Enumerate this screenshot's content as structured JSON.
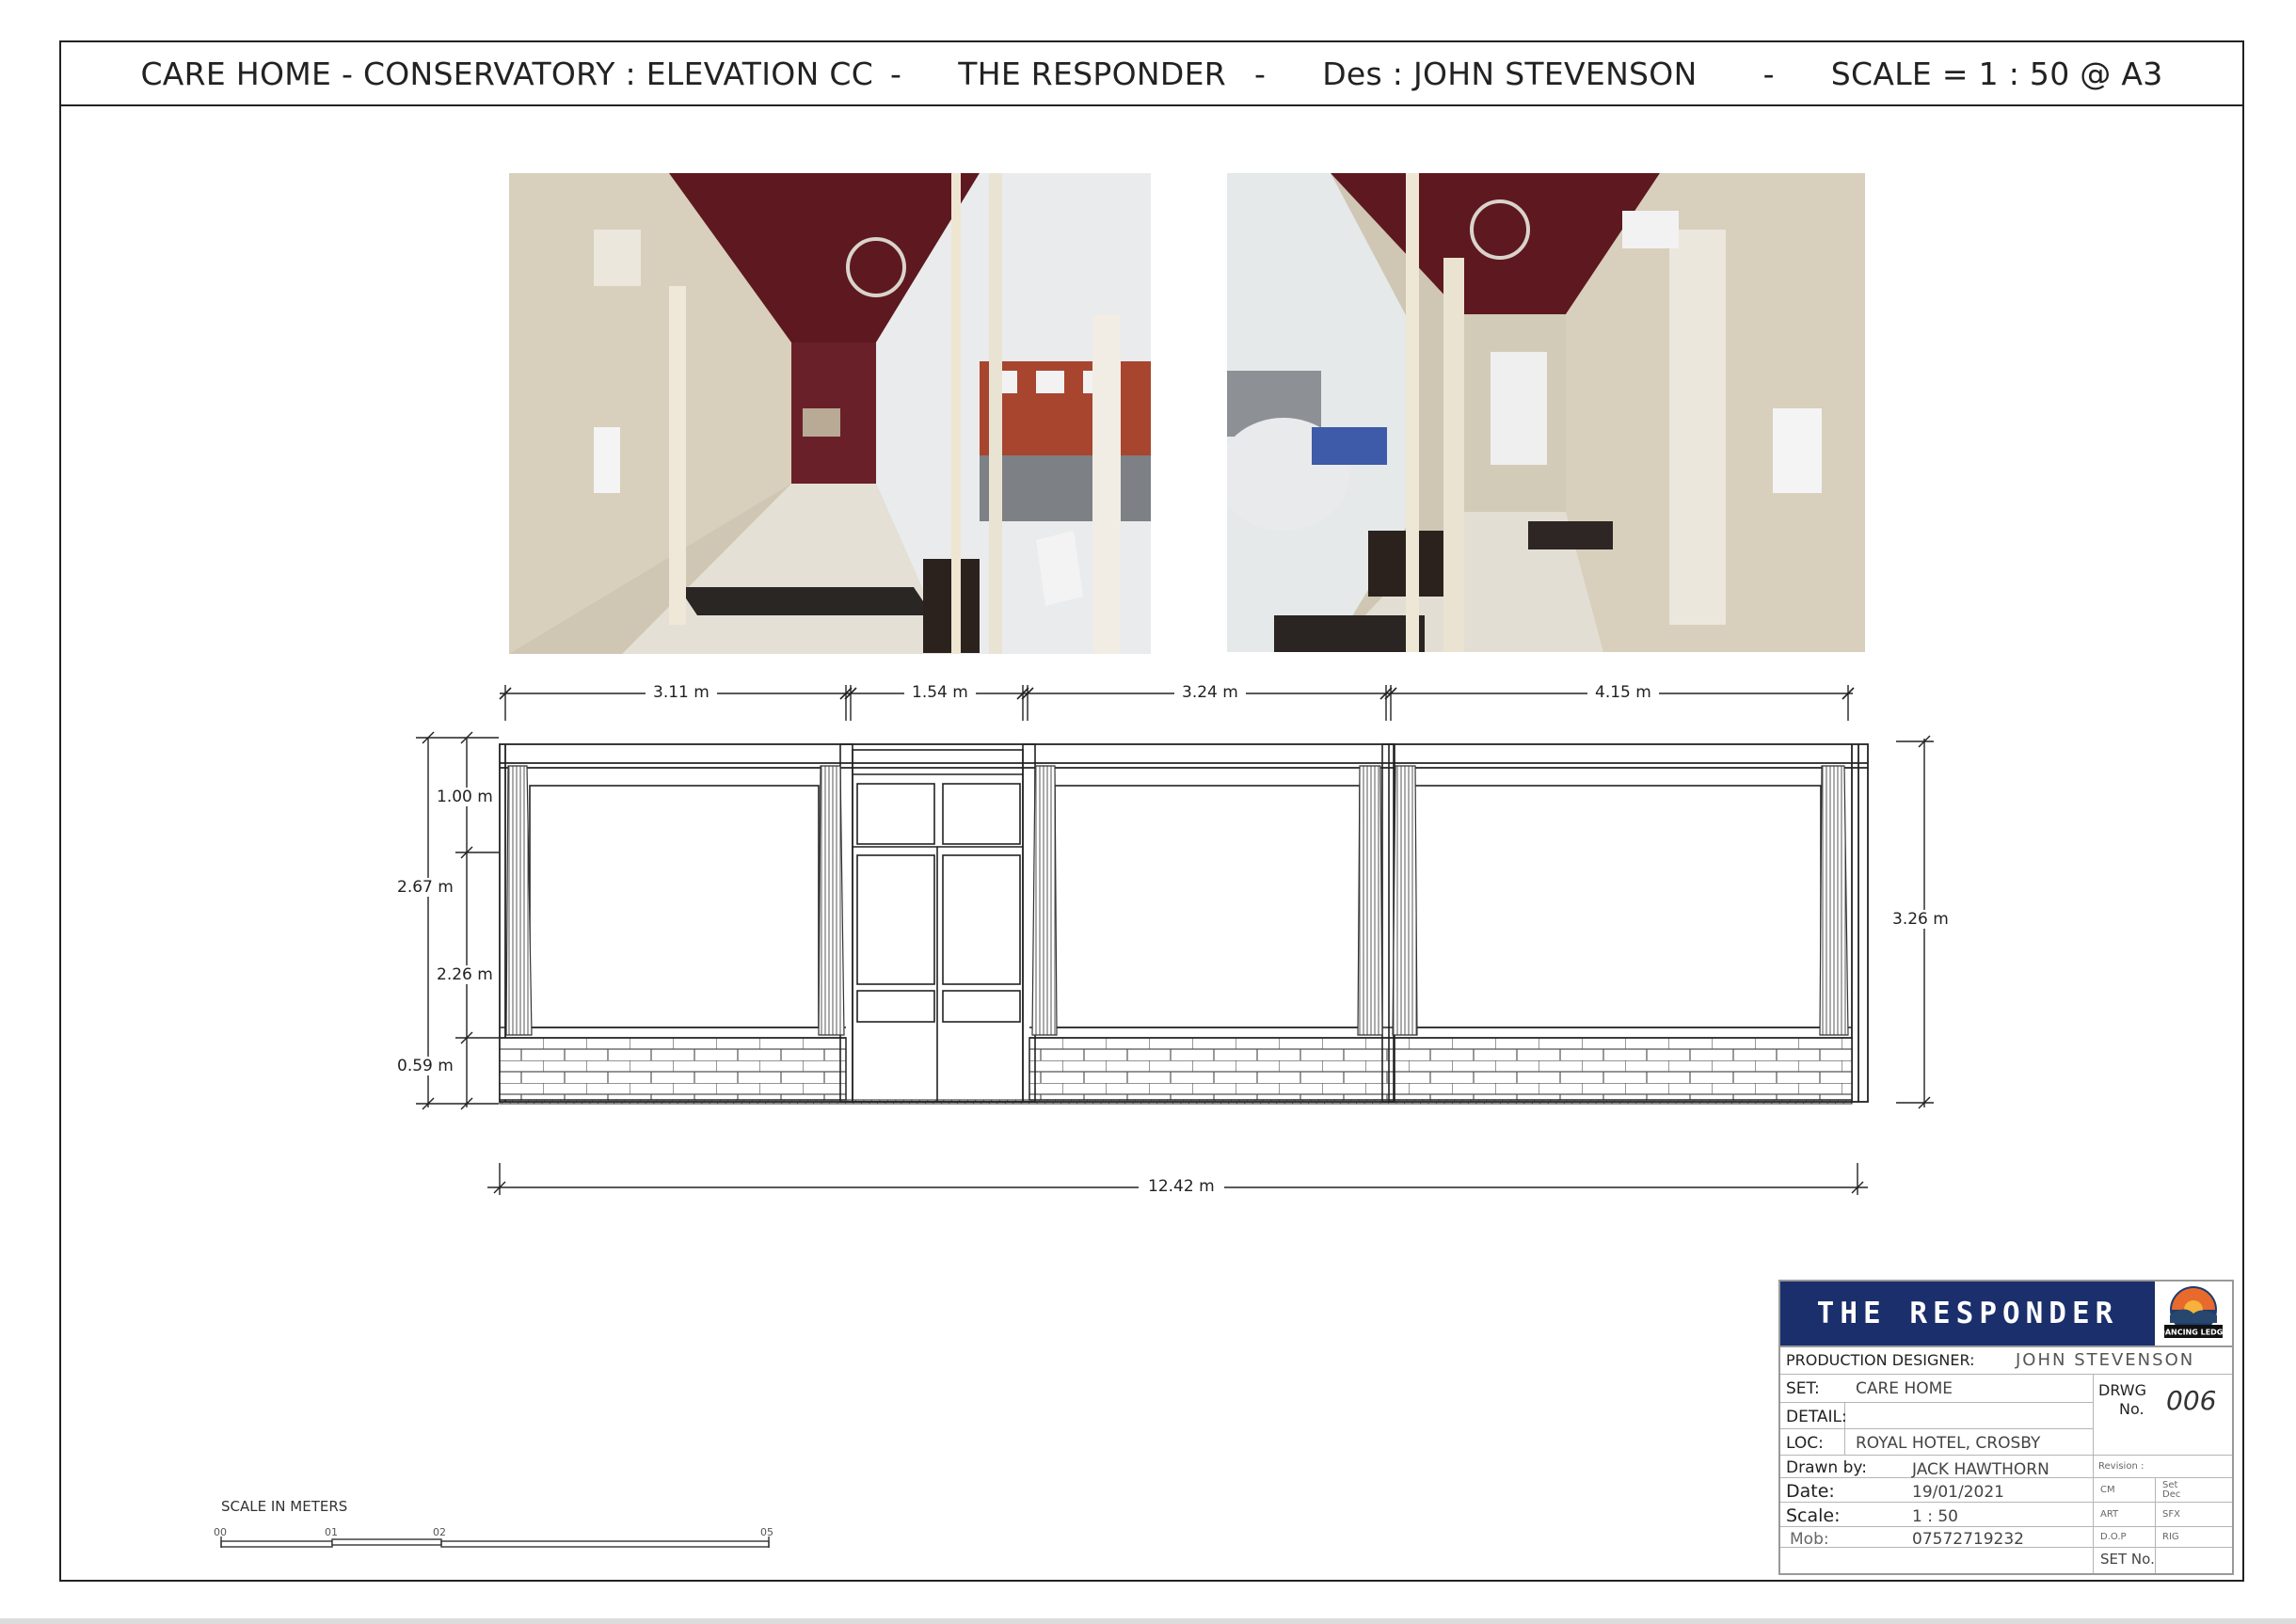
{
  "header": {
    "title": "CARE HOME - CONSERVATORY : ELEVATION CC",
    "sep1": "-",
    "production": "THE RESPONDER",
    "sep2": "-",
    "designer": "Des : JOHN STEVENSON",
    "sep3": "-",
    "scale": "SCALE = 1 : 50 @ A3"
  },
  "dimensions": {
    "top": [
      "3.11 m",
      "1.54 m",
      "3.24 m",
      "4.15 m"
    ],
    "left": [
      "1.00 m",
      "2.67 m",
      "2.26 m",
      "0.59 m"
    ],
    "right": "3.26 m",
    "bottom": "12.42 m"
  },
  "scale_bar": {
    "title": "SCALE IN METERS",
    "ticks": [
      "00",
      "01",
      "02",
      "05"
    ]
  },
  "title_block": {
    "production": "THE RESPONDER",
    "logo_text": "DANCING LEDGE",
    "production_designer_label": "PRODUCTION DESIGNER:",
    "production_designer": "JOHN STEVENSON",
    "set_label": "SET:",
    "set": "CARE HOME",
    "detail_label": "DETAIL:",
    "detail": "",
    "loc_label": "LOC:",
    "loc": "ROYAL HOTEL, CROSBY",
    "drwg_label_1": "DRWG",
    "drwg_label_2": "No.",
    "drwg_no": "006",
    "revision_label": "Revision :",
    "drawn_by_label": "Drawn by:",
    "drawn_by": "JACK HAWTHORN",
    "date_label": "Date:",
    "date": "19/01/2021",
    "scale_label": "Scale:",
    "scale": "1 : 50",
    "mob_label": "Mob:",
    "mob": "07572719232",
    "set_no_label": "SET No.",
    "dept": [
      "CM",
      "Set Dec",
      "ART",
      "SFX",
      "D.O.P",
      "RIG"
    ]
  },
  "colors": {
    "title_banner": "#1a2f6b",
    "ceiling_red": "#6b1a22",
    "wall_cream": "#d9d0bf"
  }
}
